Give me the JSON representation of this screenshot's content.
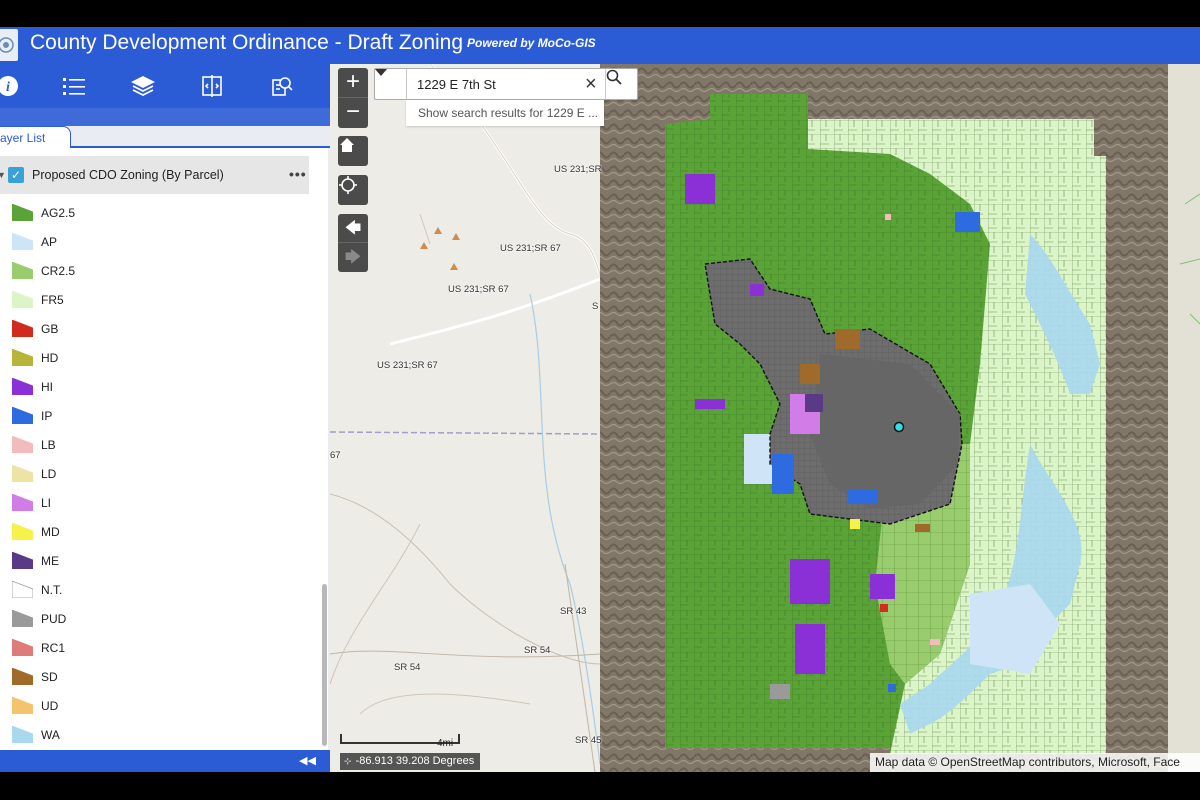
{
  "app": {
    "title": "County Development Ordinance - Draft Zoning",
    "powered_by": "Powered by MoCo-GIS"
  },
  "toolbar": {
    "tools": [
      "info-icon",
      "legend-list-icon",
      "layers-icon",
      "swipe-icon",
      "query-icon"
    ]
  },
  "panel": {
    "tab_label": "ayer List",
    "layer": {
      "name": "Proposed CDO Zoning (By Parcel)",
      "checked": true,
      "more": "•••"
    },
    "legend": [
      {
        "label": "AG2.5",
        "color": "#5aa337"
      },
      {
        "label": "AP",
        "color": "#cfe5f7"
      },
      {
        "label": "CR2.5",
        "color": "#98cc6c"
      },
      {
        "label": "FR5",
        "color": "#dcf5c8"
      },
      {
        "label": "GB",
        "color": "#d12a1f"
      },
      {
        "label": "HD",
        "color": "#b8b43a"
      },
      {
        "label": "HI",
        "color": "#8b2fd6"
      },
      {
        "label": "IP",
        "color": "#2e6ae0"
      },
      {
        "label": "LB",
        "color": "#f3bcbc"
      },
      {
        "label": "LD",
        "color": "#ede3a4"
      },
      {
        "label": "LI",
        "color": "#d27ce8"
      },
      {
        "label": "MD",
        "color": "#f6f24a"
      },
      {
        "label": "ME",
        "color": "#5a3a86"
      },
      {
        "label": "N.T.",
        "color": "#ffffff"
      },
      {
        "label": "PUD",
        "color": "#9a9a9a"
      },
      {
        "label": "RC1",
        "color": "#e07b7b"
      },
      {
        "label": "SD",
        "color": "#a06a2a"
      },
      {
        "label": "UD",
        "color": "#f4c46c"
      },
      {
        "label": "WA",
        "color": "#a8d8ee"
      }
    ]
  },
  "search": {
    "value": "1229 E 7th St",
    "suggestion": "Show search results for 1229 E ..."
  },
  "map": {
    "road_labels": [
      "US 231;SR",
      "US 231;SR 67",
      "US 231;SR 67",
      "US 231;SR 67",
      "SR 43",
      "SR 54",
      "SR 54",
      "SR 45",
      "67",
      "S"
    ],
    "scale": "4mi",
    "coordinates": "-86.913 39.208 Degrees",
    "attribution": "Map data © OpenStreetMap contributors, Microsoft, Face"
  }
}
